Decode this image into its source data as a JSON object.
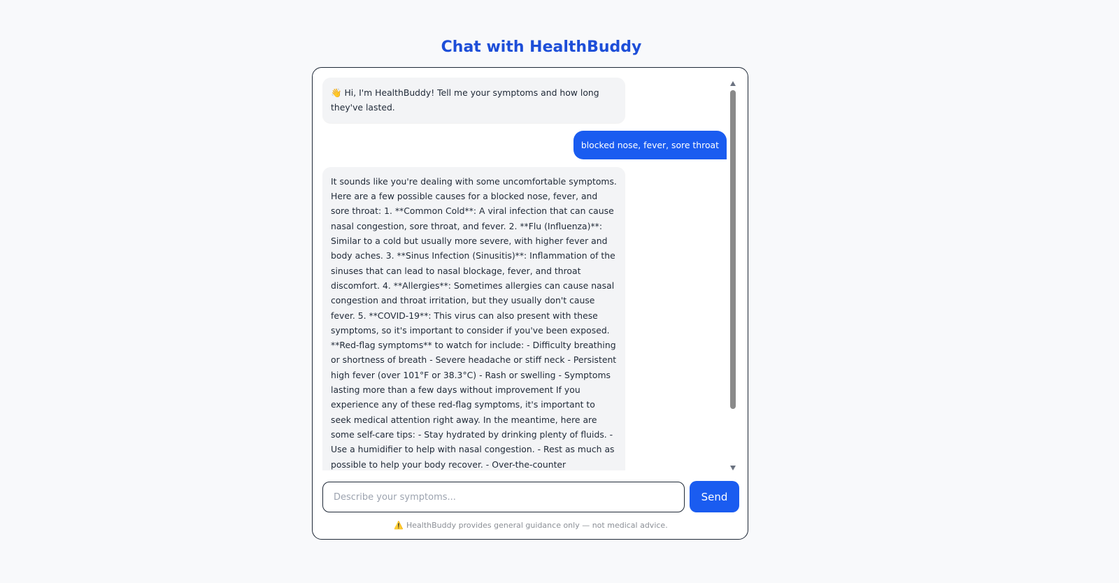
{
  "header": {
    "title": "Chat with HealthBuddy"
  },
  "messages": [
    {
      "role": "bot",
      "icon": "👋",
      "text": "Hi, I'm HealthBuddy! Tell me your symptoms and how long they've lasted."
    },
    {
      "role": "user",
      "text": "blocked nose, fever, sore throat"
    },
    {
      "role": "bot",
      "text": "It sounds like you're dealing with some uncomfortable symptoms. Here are a few possible causes for a blocked nose, fever, and sore throat: 1. **Common Cold**: A viral infection that can cause nasal congestion, sore throat, and fever. 2. **Flu (Influenza)**: Similar to a cold but usually more severe, with higher fever and body aches. 3. **Sinus Infection (Sinusitis)**: Inflammation of the sinuses that can lead to nasal blockage, fever, and throat discomfort. 4. **Allergies**: Sometimes allergies can cause nasal congestion and throat irritation, but they usually don't cause fever. 5. **COVID-19**: This virus can also present with these symptoms, so it's important to consider if you've been exposed. **Red-flag symptoms** to watch for include: - Difficulty breathing or shortness of breath - Severe headache or stiff neck - Persistent high fever (over 101°F or 38.3°C) - Rash or swelling - Symptoms lasting more than a few days without improvement If you experience any of these red-flag symptoms, it's important to seek medical attention right away. In the meantime, here are some self-care tips: - Stay hydrated by drinking plenty of fluids. - Use a humidifier to help with nasal congestion. - Rest as much as possible to help your body recover. - Over-the-counter medications may help relieve symptoms (like pain relievers or decongestants), but check with a"
    }
  ],
  "composer": {
    "placeholder": "Describe your symptoms...",
    "value": "",
    "send_label": "Send"
  },
  "footer": {
    "warning_icon": "⚠️",
    "disclaimer": "HealthBuddy provides general guidance only — not medical advice."
  },
  "colors": {
    "accent": "#1a5cf0",
    "title": "#1d4ed8",
    "bot_bubble": "#f3f4f6"
  }
}
